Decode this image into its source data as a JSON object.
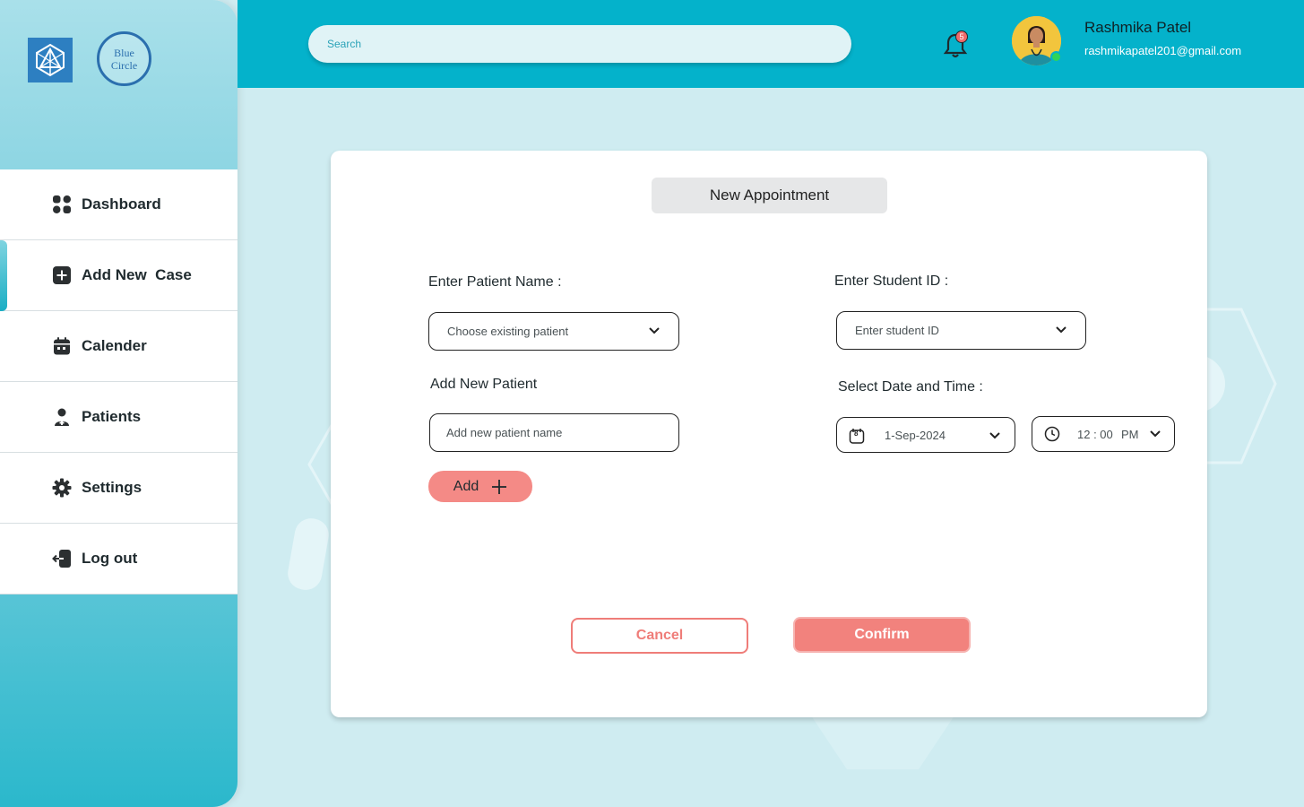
{
  "brand": {
    "logo_b_line1": "Blue",
    "logo_b_line2": "Circle"
  },
  "sidebar": {
    "items": [
      {
        "label": "Dashboard",
        "icon": "dashboard-grid-icon"
      },
      {
        "label": "Add New  Case",
        "icon": "plus-square-icon",
        "active": true
      },
      {
        "label": "Calender",
        "icon": "calendar-icon"
      },
      {
        "label": "Patients",
        "icon": "patient-icon"
      },
      {
        "label": "Settings",
        "icon": "gear-icon"
      },
      {
        "label": "Log out",
        "icon": "logout-icon"
      }
    ]
  },
  "header": {
    "search_placeholder": "Search",
    "notification_count": "5",
    "user_name": "Rashmika Patel",
    "user_email": "rashmikapatel201@gmail.com"
  },
  "form": {
    "title": "New Appointment",
    "patient_name_label": "Enter Patient Name :",
    "patient_select_value": "Choose existing patient",
    "add_new_patient_label": "Add New Patient",
    "add_new_patient_placeholder": "Add new patient name",
    "add_button_label": "Add",
    "student_id_label": "Enter Student ID :",
    "student_id_value": "Enter student ID",
    "date_time_label": "Select Date and Time :",
    "date_value": "1-Sep-2024",
    "calendar_day": "8",
    "time_value": "12 : 00",
    "time_period": "PM",
    "cancel_label": "Cancel",
    "confirm_label": "Confirm"
  },
  "colors": {
    "header_bg": "#04b2cb",
    "accent_coral": "#f2827d",
    "page_bg": "#cfecf1"
  }
}
